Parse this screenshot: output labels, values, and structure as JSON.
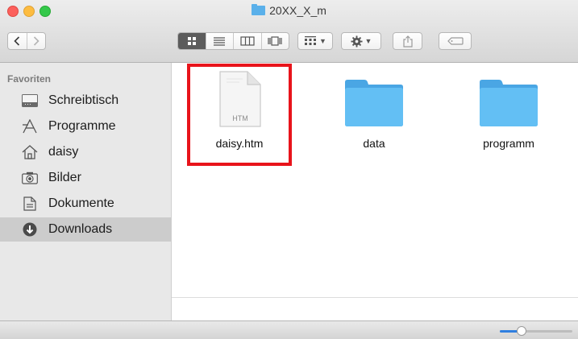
{
  "window": {
    "title": "20XX_X_m"
  },
  "toolbar": {
    "back_icon": "chevron-left-icon",
    "forward_icon": "chevron-right-icon",
    "views": [
      "icon-view",
      "list-view",
      "column-view",
      "cover-flow-view"
    ],
    "active_view": "icon-view",
    "arrange_icon": "arrange-grid-icon",
    "action_icon": "gear-icon",
    "share_icon": "share-icon",
    "tag_icon": "tag-icon"
  },
  "sidebar": {
    "heading": "Favoriten",
    "items": [
      {
        "label": "Schreibtisch",
        "icon": "desktop-icon"
      },
      {
        "label": "Programme",
        "icon": "applications-icon"
      },
      {
        "label": "daisy",
        "icon": "home-icon"
      },
      {
        "label": "Bilder",
        "icon": "camera-icon"
      },
      {
        "label": "Dokumente",
        "icon": "document-icon"
      },
      {
        "label": "Downloads",
        "icon": "download-icon",
        "selected": true
      }
    ]
  },
  "files": [
    {
      "name": "daisy.htm",
      "type": "file",
      "badge": "HTM",
      "highlighted": true
    },
    {
      "name": "data",
      "type": "folder"
    },
    {
      "name": "programm",
      "type": "folder"
    }
  ],
  "statusbar": {
    "icon_size_fraction": 0.3
  },
  "colors": {
    "folder": "#5ab6f0",
    "selection_highlight": "#e8141b",
    "sidebar_selected": "#cccccc"
  }
}
